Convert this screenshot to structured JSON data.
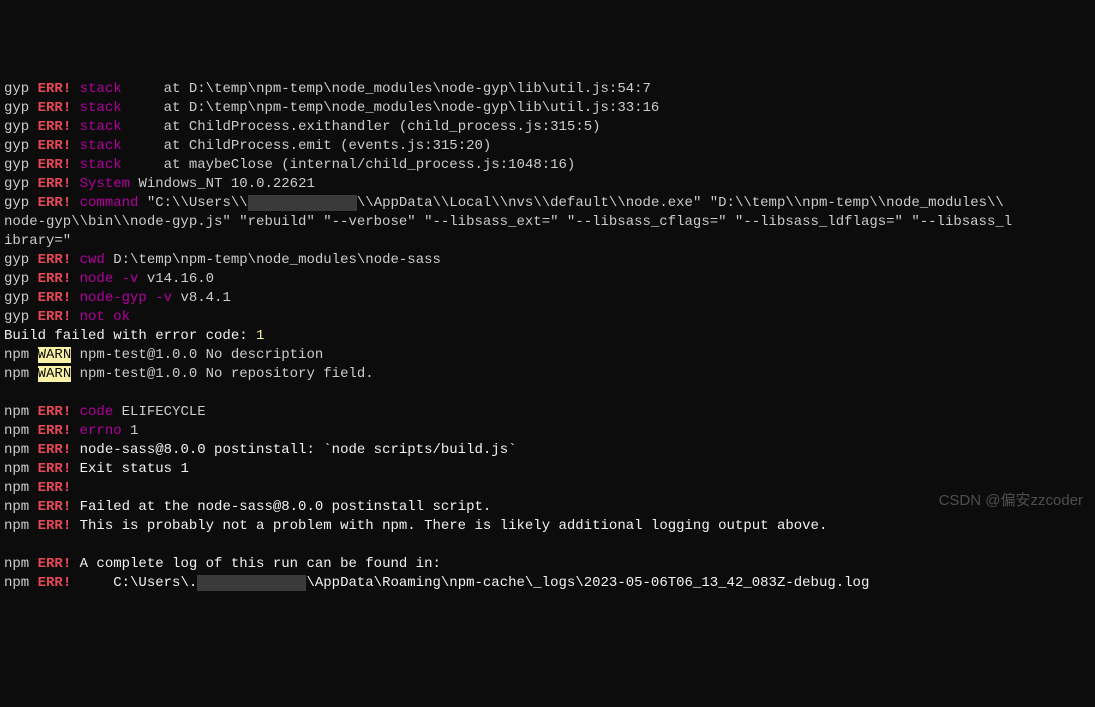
{
  "lines": [
    {
      "prefix": "gyp",
      "tag": "ERR!",
      "tagClass": "err",
      "label": "stack",
      "labelClass": "magenta",
      "rest": "    at D:\\temp\\npm-temp\\node_modules\\node-gyp\\lib\\util.js:54:7"
    },
    {
      "prefix": "gyp",
      "tag": "ERR!",
      "tagClass": "err",
      "label": "stack",
      "labelClass": "magenta",
      "rest": "    at D:\\temp\\npm-temp\\node_modules\\node-gyp\\lib\\util.js:33:16"
    },
    {
      "prefix": "gyp",
      "tag": "ERR!",
      "tagClass": "err",
      "label": "stack",
      "labelClass": "magenta",
      "rest": "    at ChildProcess.exithandler (child_process.js:315:5)"
    },
    {
      "prefix": "gyp",
      "tag": "ERR!",
      "tagClass": "err",
      "label": "stack",
      "labelClass": "magenta",
      "rest": "    at ChildProcess.emit (events.js:315:20)"
    },
    {
      "prefix": "gyp",
      "tag": "ERR!",
      "tagClass": "err",
      "label": "stack",
      "labelClass": "magenta",
      "rest": "    at maybeClose (internal/child_process.js:1048:16)"
    },
    {
      "prefix": "gyp",
      "tag": "ERR!",
      "tagClass": "err",
      "label": "System",
      "labelClass": "magenta",
      "rest": "Windows_NT 10.0.22621"
    },
    {
      "prefix": "gyp",
      "tag": "ERR!",
      "tagClass": "err",
      "label": "command",
      "labelClass": "magenta",
      "rest": "\"C:\\\\Users\\\\",
      "redacted": "             ",
      "rest2": "\\\\AppData\\\\Local\\\\nvs\\\\default\\\\node.exe\" \"D:\\\\temp\\\\npm-temp\\\\node_modules\\\\"
    },
    {
      "raw": "node-gyp\\\\bin\\\\node-gyp.js\" \"rebuild\" \"--verbose\" \"--libsass_ext=\" \"--libsass_cflags=\" \"--libsass_ldflags=\" \"--libsass_l"
    },
    {
      "raw": "ibrary=\""
    },
    {
      "prefix": "gyp",
      "tag": "ERR!",
      "tagClass": "err",
      "label": "cwd",
      "labelClass": "magenta",
      "rest": "D:\\temp\\npm-temp\\node_modules\\node-sass"
    },
    {
      "prefix": "gyp",
      "tag": "ERR!",
      "tagClass": "err",
      "label": "node -v",
      "labelClass": "magenta",
      "rest": "v14.16.0"
    },
    {
      "prefix": "gyp",
      "tag": "ERR!",
      "tagClass": "err",
      "label": "node-gyp -v",
      "labelClass": "magenta",
      "rest": "v8.4.1"
    },
    {
      "prefix": "gyp",
      "tag": "ERR!",
      "tagClass": "err",
      "label": "not ok",
      "labelClass": "magenta",
      "rest": ""
    },
    {
      "raw": "Build failed with error code: ",
      "rawClass": "white",
      "yellow": "1"
    },
    {
      "prefix": "npm",
      "tag": "WARN",
      "tagClass": "warn-bg",
      "label": "",
      "labelClass": "",
      "rest": "npm-test@1.0.0 No description"
    },
    {
      "prefix": "npm",
      "tag": "WARN",
      "tagClass": "warn-bg",
      "label": "",
      "labelClass": "",
      "rest": "npm-test@1.0.0 No repository field."
    },
    {
      "blank": true
    },
    {
      "prefix": "npm",
      "tag": "ERR!",
      "tagClass": "err",
      "label": "code",
      "labelClass": "magenta",
      "rest": "ELIFECYCLE"
    },
    {
      "prefix": "npm",
      "tag": "ERR!",
      "tagClass": "err",
      "label": "errno",
      "labelClass": "magenta",
      "rest": "1"
    },
    {
      "prefix": "npm",
      "tag": "ERR!",
      "tagClass": "err",
      "label": "",
      "labelClass": "",
      "rest": "node-sass@8.0.0 postinstall: `node scripts/build.js`",
      "restClass": "white"
    },
    {
      "prefix": "npm",
      "tag": "ERR!",
      "tagClass": "err",
      "label": "",
      "labelClass": "",
      "rest": "Exit status 1",
      "restClass": "white"
    },
    {
      "prefix": "npm",
      "tag": "ERR!",
      "tagClass": "err",
      "label": "",
      "labelClass": "",
      "rest": ""
    },
    {
      "prefix": "npm",
      "tag": "ERR!",
      "tagClass": "err",
      "label": "",
      "labelClass": "",
      "rest": "Failed at the node-sass@8.0.0 postinstall script.",
      "restClass": "white"
    },
    {
      "prefix": "npm",
      "tag": "ERR!",
      "tagClass": "err",
      "label": "",
      "labelClass": "",
      "rest": "This is probably not a problem with npm. There is likely additional logging output above.",
      "restClass": "white"
    },
    {
      "blank": true
    },
    {
      "prefix": "npm",
      "tag": "ERR!",
      "tagClass": "err",
      "label": "",
      "labelClass": "",
      "rest": "A complete log of this run can be found in:",
      "restClass": "white"
    },
    {
      "prefix": "npm",
      "tag": "ERR!",
      "tagClass": "err",
      "label": "",
      "labelClass": "",
      "rest": "    C:\\Users\\.",
      "restClass": "white",
      "redacted": "             ",
      "rest2": "\\AppData\\Roaming\\npm-cache\\_logs\\2023-05-06T06_13_42_083Z-debug.log",
      "rest2Class": "white"
    }
  ],
  "watermark": "CSDN @偏安zzcoder"
}
